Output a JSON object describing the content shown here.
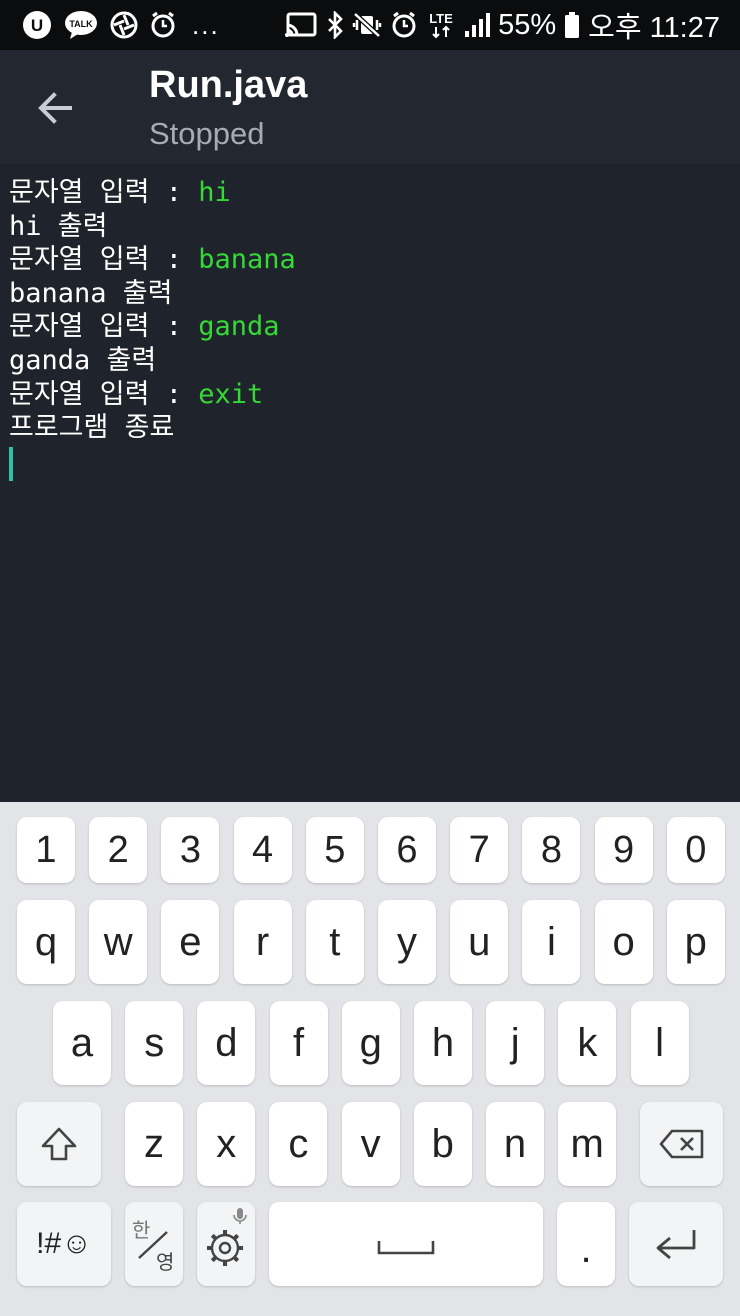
{
  "status_bar": {
    "left_icons": [
      "u-plus-icon",
      "kakaotalk-icon",
      "camera-aperture-icon",
      "alarm-icon"
    ],
    "talk_label": "TALK",
    "overflow": "...",
    "network": "LTE",
    "battery": "55%",
    "time": "오후 11:27"
  },
  "app_bar": {
    "title": "Run.java",
    "subtitle": "Stopped"
  },
  "console": {
    "lines": [
      {
        "prompt": "문자열 입력 : ",
        "input": "hi"
      },
      {
        "text": "hi 출력"
      },
      {
        "prompt": "문자열 입력 : ",
        "input": "banana"
      },
      {
        "text": "banana 출력"
      },
      {
        "prompt": "문자열 입력 : ",
        "input": "ganda"
      },
      {
        "text": "ganda 출력"
      },
      {
        "prompt": "문자열 입력 : ",
        "input": "exit"
      },
      {
        "text": "프로그램 종료"
      }
    ],
    "input_color": "#35d935",
    "cursor_color": "#2ac3a5"
  },
  "keyboard": {
    "number_row": [
      "1",
      "2",
      "3",
      "4",
      "5",
      "6",
      "7",
      "8",
      "9",
      "0"
    ],
    "row1": [
      "q",
      "w",
      "e",
      "r",
      "t",
      "y",
      "u",
      "i",
      "o",
      "p"
    ],
    "row2": [
      "a",
      "s",
      "d",
      "f",
      "g",
      "h",
      "j",
      "k",
      "l"
    ],
    "row3": [
      "z",
      "x",
      "c",
      "v",
      "b",
      "n",
      "m"
    ],
    "symbols_label": "!#☺",
    "lang_top": "한",
    "lang_bottom": "영",
    "period": "."
  }
}
